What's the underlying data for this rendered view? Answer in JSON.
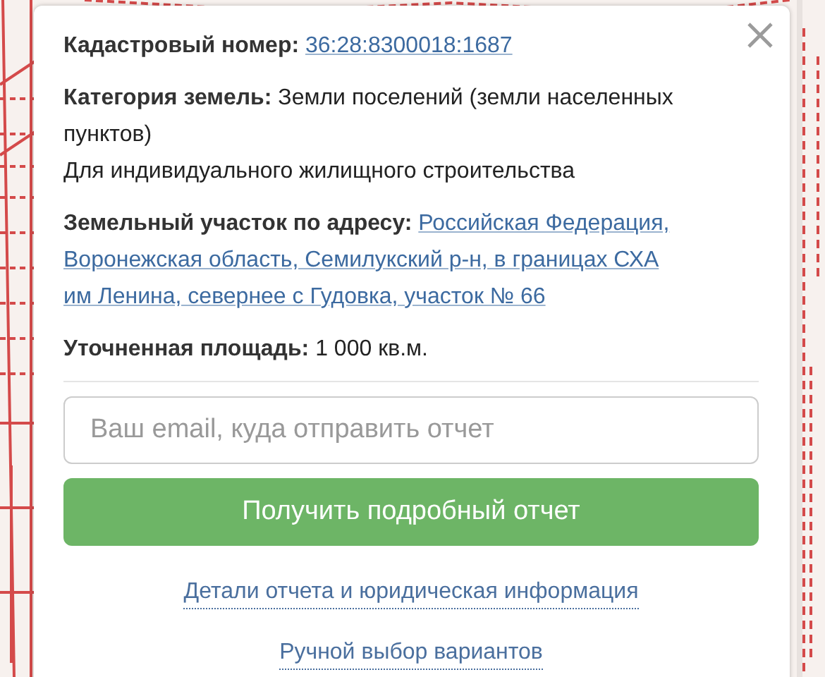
{
  "popup": {
    "fields": [
      {
        "kind": "link",
        "label": "Кадастровый номер:",
        "value": "36:28:8300018:1687"
      },
      {
        "kind": "text",
        "label": "Категория земель:",
        "value": "Земли поселений (земли населенных пунктов)",
        "note": "Для индивидуального жилищного строительства"
      },
      {
        "kind": "link",
        "label": "Земельный участок по адресу:",
        "value_lines": [
          "Российская Федерация,",
          "Воронежская область, Семилукский р-н, в границах СХА",
          "им Ленина, севернее с Гудовка, участок № 66"
        ]
      },
      {
        "kind": "text",
        "label": "Уточненная площадь:",
        "value": "1 000 кв.м."
      }
    ],
    "email": {
      "placeholder": "Ваш email, куда отправить отчет"
    },
    "submit": "Получить подробный отчет",
    "links": [
      "Детали отчета и юридическая информация",
      "Ручной выбор вариантов"
    ]
  }
}
